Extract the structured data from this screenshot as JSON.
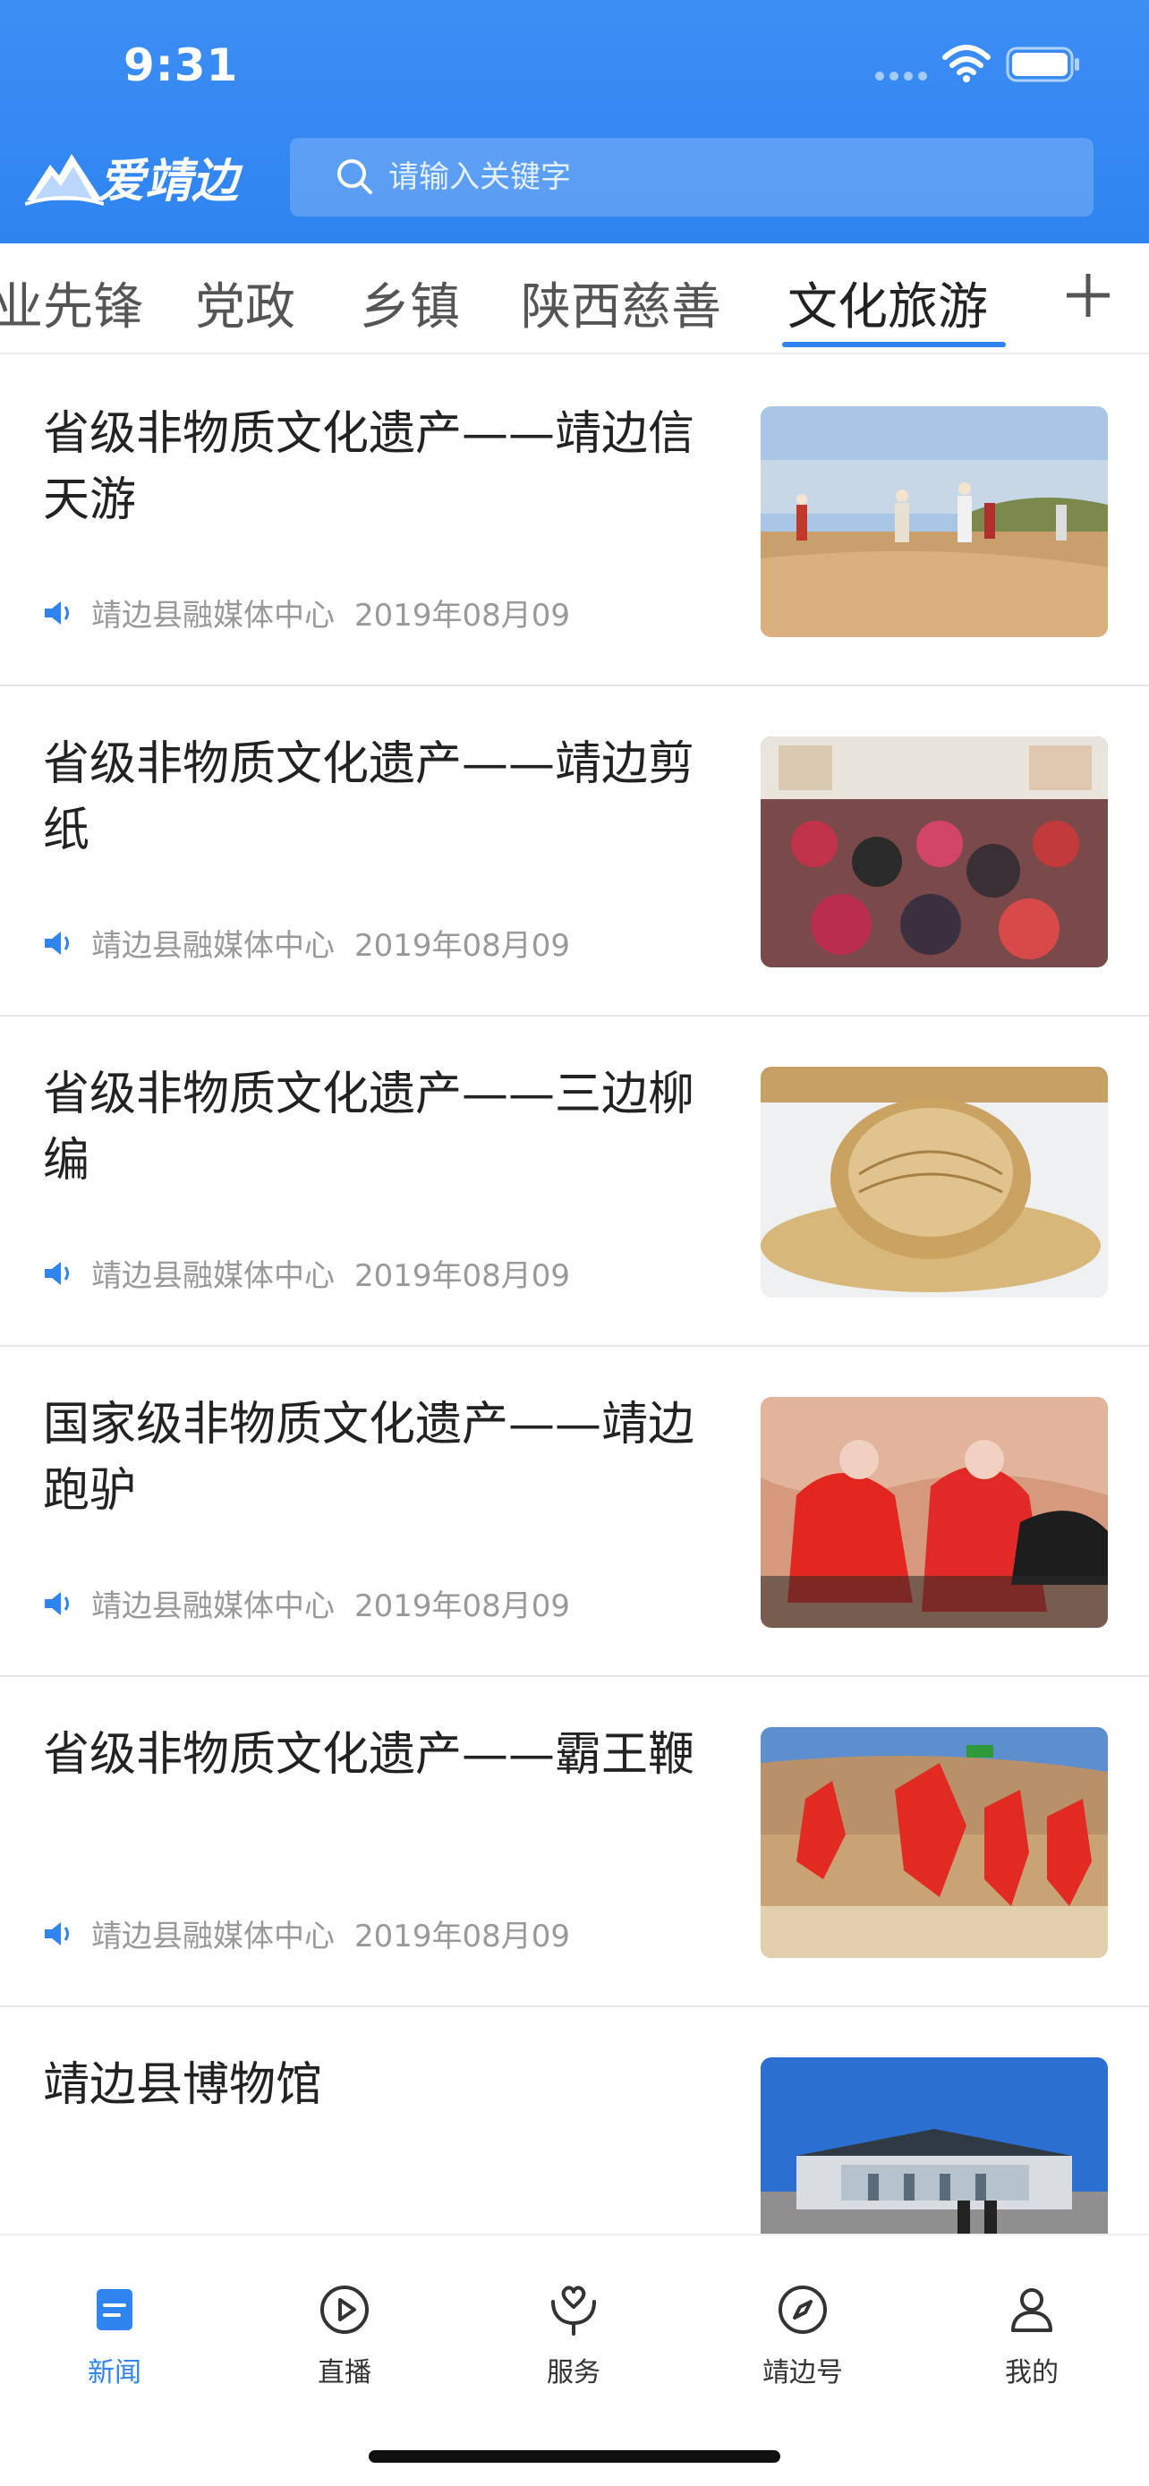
{
  "status_bar": {
    "time": "9:31"
  },
  "header": {
    "logo_text": "爱靖边",
    "search_placeholder": "请输入关键字"
  },
  "tabs": {
    "items": [
      {
        "label": "业先锋",
        "active": false
      },
      {
        "label": "党政",
        "active": false
      },
      {
        "label": "乡镇",
        "active": false
      },
      {
        "label": "陕西慈善",
        "active": false
      },
      {
        "label": "文化旅游",
        "active": true
      }
    ],
    "add_icon": "plus-icon"
  },
  "feed": {
    "items": [
      {
        "title": "省级非物质文化遗产——靖边信天游",
        "source": "靖边县融媒体中心",
        "date": "2019年08月09"
      },
      {
        "title": "省级非物质文化遗产——靖边剪纸",
        "source": "靖边县融媒体中心",
        "date": "2019年08月09"
      },
      {
        "title": "省级非物质文化遗产——三边柳编",
        "source": "靖边县融媒体中心",
        "date": "2019年08月09"
      },
      {
        "title": "国家级非物质文化遗产——靖边跑驴",
        "source": "靖边县融媒体中心",
        "date": "2019年08月09"
      },
      {
        "title": "省级非物质文化遗产——霸王鞭",
        "source": "靖边县融媒体中心",
        "date": "2019年08月09"
      },
      {
        "title": "靖边县博物馆",
        "source": "",
        "date": ""
      }
    ]
  },
  "bottom_nav": {
    "items": [
      {
        "label": "新闻",
        "icon": "news-icon",
        "active": true
      },
      {
        "label": "直播",
        "icon": "play-icon",
        "active": false
      },
      {
        "label": "服务",
        "icon": "service-icon",
        "active": false
      },
      {
        "label": "靖边号",
        "icon": "compass-icon",
        "active": false
      },
      {
        "label": "我的",
        "icon": "user-icon",
        "active": false
      }
    ]
  },
  "colors": {
    "accent": "#2f84f0",
    "header_bg": "#3d8ef5",
    "meta_text": "#999999"
  }
}
